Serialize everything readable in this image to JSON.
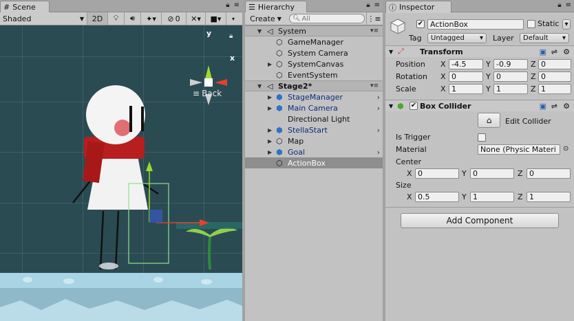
{
  "scene": {
    "tab_label": "Scene",
    "shading_mode": "Shaded",
    "mode_2d": "2D",
    "hidden_count": "0",
    "gizmo": {
      "axis_y": "y",
      "axis_x": "x"
    },
    "back_label": "Back"
  },
  "hierarchy": {
    "tab_label": "Hierarchy",
    "create_label": "Create",
    "search_placeholder": "All",
    "rows": [
      {
        "label": "System",
        "type": "scene"
      },
      {
        "label": "GameManager",
        "type": "object"
      },
      {
        "label": "System Camera",
        "type": "object"
      },
      {
        "label": "SystemCanvas",
        "type": "object"
      },
      {
        "label": "EventSystem",
        "type": "object"
      },
      {
        "label": "Stage2*",
        "type": "scene"
      },
      {
        "label": "StageManager",
        "type": "prefab"
      },
      {
        "label": "Main Camera",
        "type": "prefab"
      },
      {
        "label": "Directional Light",
        "type": "object"
      },
      {
        "label": "StellaStart",
        "type": "prefab"
      },
      {
        "label": "Map",
        "type": "object"
      },
      {
        "label": "Goal",
        "type": "prefab"
      },
      {
        "label": "ActionBox",
        "type": "object",
        "selected": true
      }
    ]
  },
  "inspector": {
    "tab_label": "Inspector",
    "object_name": "ActionBox",
    "active": true,
    "static_label": "Static",
    "static_checked": false,
    "tag_label": "Tag",
    "tag_value": "Untagged",
    "layer_label": "Layer",
    "layer_value": "Default",
    "transform": {
      "title": "Transform",
      "position_label": "Position",
      "rotation_label": "Rotation",
      "scale_label": "Scale",
      "position": {
        "x": "-4.5",
        "y": "-0.9",
        "z": "0"
      },
      "rotation": {
        "x": "0",
        "y": "0",
        "z": "0"
      },
      "scale": {
        "x": "1",
        "y": "1",
        "z": "1"
      }
    },
    "box_collider": {
      "title": "Box Collider",
      "enabled": true,
      "edit_collider_label": "Edit Collider",
      "is_trigger_label": "Is Trigger",
      "is_trigger": false,
      "material_label": "Material",
      "material_value": "None (Physic Materi",
      "center_label": "Center",
      "center": {
        "x": "0",
        "y": "0",
        "z": "0"
      },
      "size_label": "Size",
      "size": {
        "x": "0.5",
        "y": "1",
        "z": "1"
      }
    },
    "axis": {
      "x": "X",
      "y": "Y",
      "z": "Z"
    },
    "add_component_label": "Add Component"
  },
  "colors": {
    "panel_bg": "#c2c2c2",
    "scene_bg": "#2b4b52",
    "selected_row": "#8e8e8e",
    "prefab_text": "#0c2c7a",
    "collider_green": "#8fe28f"
  }
}
